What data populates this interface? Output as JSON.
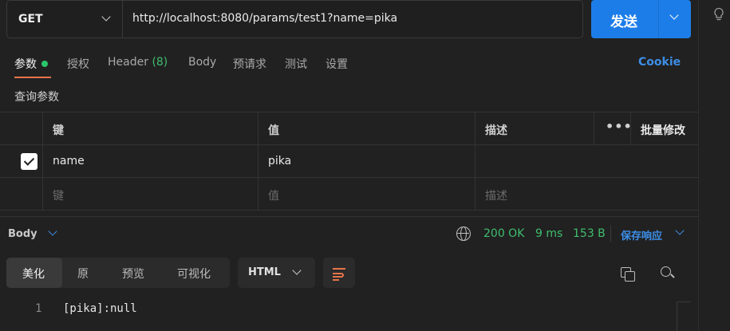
{
  "request": {
    "method": "GET",
    "url": "http://localhost:8080/params/test1?name=pika",
    "send_label": "发送"
  },
  "tabs": [
    {
      "label": "参数",
      "active": true
    },
    {
      "label": "授权"
    },
    {
      "label": "Header",
      "count": "(8)"
    },
    {
      "label": "Body"
    },
    {
      "label": "预请求"
    },
    {
      "label": "测试"
    },
    {
      "label": "设置"
    }
  ],
  "cookie_label": "Cookie",
  "query_params": {
    "title": "查询参数",
    "headers": {
      "key": "键",
      "value": "值",
      "description": "描述",
      "more": "•••",
      "bulk_edit": "批量修改"
    },
    "rows": [
      {
        "checked": true,
        "key": "name",
        "value": "pika",
        "description": ""
      }
    ],
    "placeholders": {
      "key": "键",
      "value": "值",
      "description": "描述"
    }
  },
  "response": {
    "body_label": "Body",
    "status": "200 OK",
    "time": "9 ms",
    "size": "153 B",
    "save_label": "保存响应",
    "view_tabs": [
      "美化",
      "原",
      "预览",
      "可视化"
    ],
    "active_view": "美化",
    "format": "HTML",
    "lines": [
      {
        "number": "1",
        "text": "[pika]:null"
      }
    ]
  },
  "colors": {
    "accent_blue": "#1d7de8",
    "status_green": "#3fbe6e",
    "active_orange": "#e8734a",
    "background": "#212121"
  }
}
